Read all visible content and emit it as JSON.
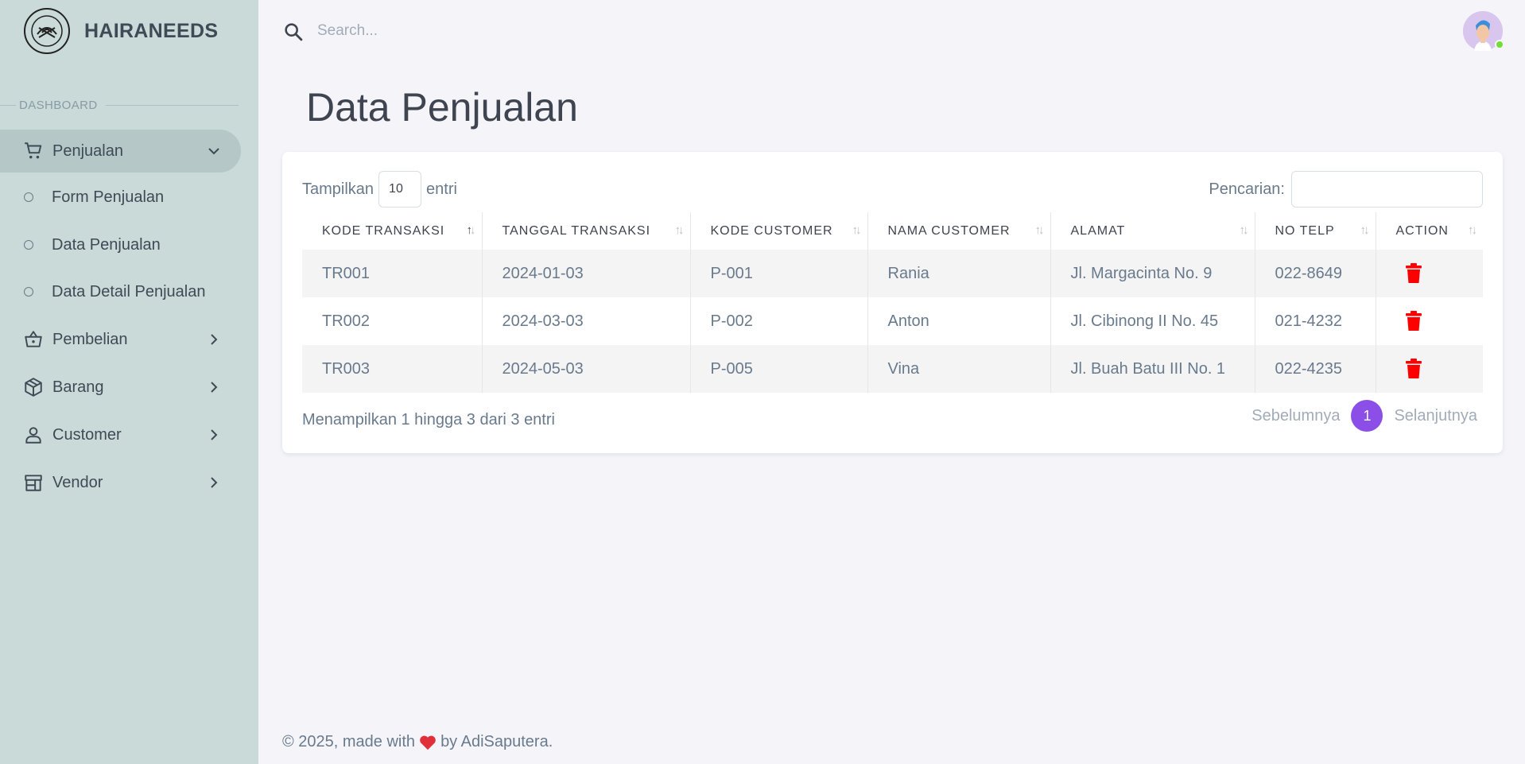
{
  "brand": {
    "name": "HAIRANEEDS"
  },
  "search": {
    "placeholder": "Search..."
  },
  "sidebar": {
    "header": "DASHBOARD",
    "items": [
      {
        "label": "Penjualan",
        "icon": "cart-icon"
      },
      {
        "label": "Form Penjualan"
      },
      {
        "label": "Data Penjualan"
      },
      {
        "label": "Data Detail Penjualan"
      },
      {
        "label": "Pembelian",
        "icon": "basket-icon"
      },
      {
        "label": "Barang",
        "icon": "box-icon"
      },
      {
        "label": "Customer",
        "icon": "user-icon"
      },
      {
        "label": "Vendor",
        "icon": "store-icon"
      }
    ]
  },
  "page": {
    "title": "Data Penjualan"
  },
  "table_controls": {
    "show_label": "Tampilkan",
    "length_value": "10",
    "entries_label": "entri",
    "search_label": "Pencarian:"
  },
  "table": {
    "columns": [
      "KODE TRANSAKSI",
      "TANGGAL TRANSAKSI",
      "KODE CUSTOMER",
      "NAMA CUSTOMER",
      "ALAMAT",
      "NO TELP",
      "ACTION"
    ],
    "rows": [
      [
        "TR001",
        "2024-01-03",
        "P-001",
        "Rania",
        "Jl. Margacinta No. 9",
        "022-8649"
      ],
      [
        "TR002",
        "2024-03-03",
        "P-002",
        "Anton",
        "Jl. Cibinong II No. 45",
        "021-4232"
      ],
      [
        "TR003",
        "2024-05-03",
        "P-005",
        "Vina",
        "Jl. Buah Batu III No. 1",
        "022-4235"
      ]
    ]
  },
  "pagination": {
    "info": "Menampilkan 1 hingga 3 dari 3 entri",
    "prev": "Sebelumnya",
    "current": "1",
    "next": "Selanjutnya"
  },
  "footer": {
    "prefix": "© 2025, made with",
    "suffix": "by AdiSaputera."
  },
  "colors": {
    "accent": "#8b4ee7",
    "sidebar_bg": "#c9dad8",
    "delete": "#ff0000"
  }
}
